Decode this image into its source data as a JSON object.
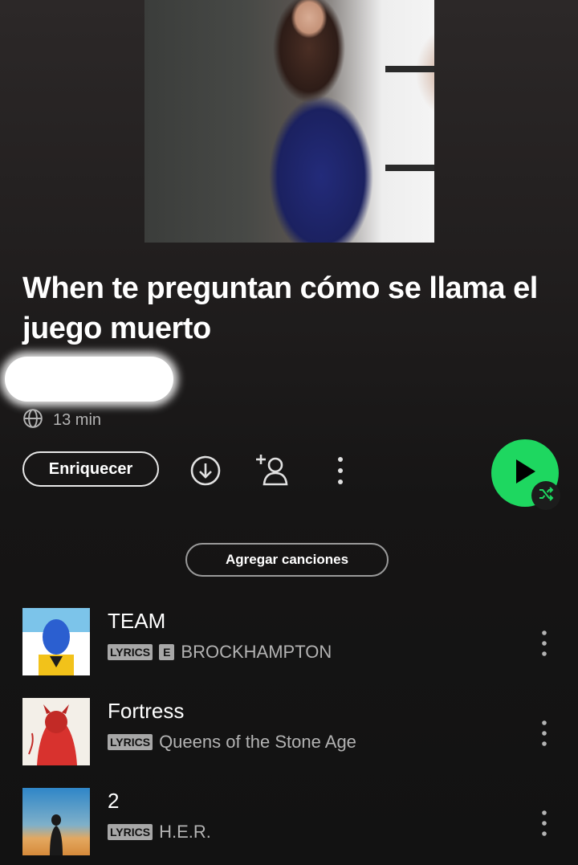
{
  "playlist": {
    "title": "When te preguntan cómo se llama el juego muerto",
    "duration": "13 min"
  },
  "actions": {
    "enrich_label": "Enriquecer",
    "add_songs_label": "Agregar canciones"
  },
  "tracks": [
    {
      "title": "TEAM",
      "lyrics_badge": "LYRICS",
      "explicit_badge": "E",
      "artist": "BROCKHAMPTON"
    },
    {
      "title": "Fortress",
      "lyrics_badge": "LYRICS",
      "artist": "Queens of the Stone Age"
    },
    {
      "title": "2",
      "lyrics_badge": "LYRICS",
      "artist": "H.E.R."
    }
  ],
  "colors": {
    "accent": "#1ed760",
    "background": "#121212",
    "secondary_text": "#b3b3b3"
  },
  "icons": [
    "globe-icon",
    "download-icon",
    "add-user-icon",
    "more-options-icon",
    "play-icon",
    "shuffle-icon"
  ]
}
